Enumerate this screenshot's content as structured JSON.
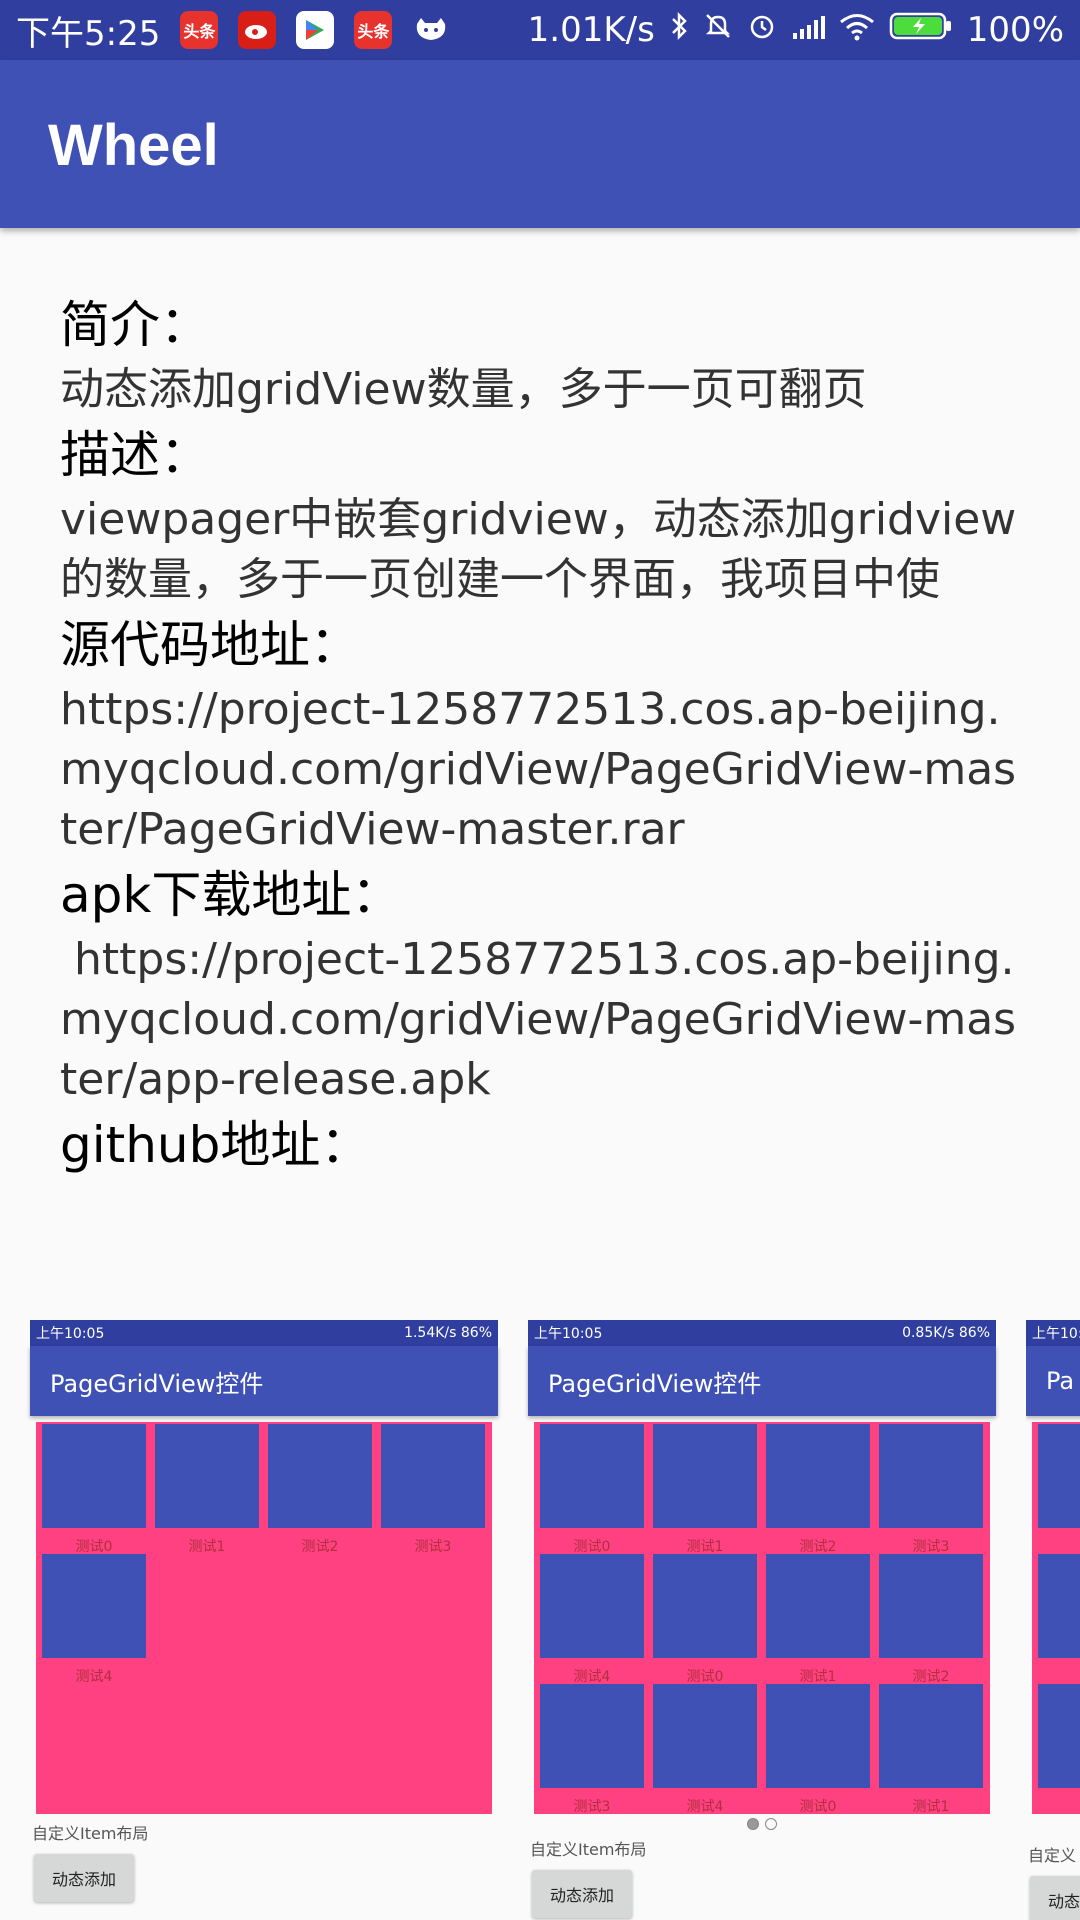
{
  "status_bar": {
    "time": "下午5:25",
    "net_speed": "1.01K/s",
    "battery": "100%",
    "app_icons": [
      "toutiao-icon",
      "weibo-icon",
      "play-store-icon",
      "toutiao-icon",
      "cat-icon"
    ]
  },
  "toolbar": {
    "title": "Wheel"
  },
  "content": {
    "intro_heading": "简介：",
    "intro_text": "动态添加gridView数量，多于一页可翻页",
    "desc_heading": "描述：",
    "desc_text": "viewpager中嵌套gridview，动态添加gridview的数量，多于一页创建一个界面，我项目中使",
    "source_heading": "源代码地址：",
    "source_url": "https://project-1258772513.cos.ap-beijing.myqcloud.com/gridView/PageGridView-master/PageGridView-master.rar",
    "apk_heading": "apk下载地址：",
    "apk_url": " https://project-1258772513.cos.ap-beijing.myqcloud.com/gridView/PageGridView-master/app-release.apk",
    "github_heading": "github地址："
  },
  "screenshots": [
    {
      "status_time": "上午10:05",
      "status_right": "1.54K/s  86%",
      "title": "PageGridView控件",
      "cells": [
        "测试0",
        "测试1",
        "测试2",
        "测试3",
        "测试4"
      ],
      "caption": "自定义Item布局",
      "button": "动态添加"
    },
    {
      "status_time": "上午10:05",
      "status_right": "0.85K/s  86%",
      "title": "PageGridView控件",
      "cells": [
        "测试0",
        "测试1",
        "测试2",
        "测试3",
        "测试4",
        "测试0",
        "测试1",
        "测试2",
        "测试3",
        "测试4",
        "测试0",
        "测试1"
      ],
      "caption": "自定义Item布局",
      "button": "动态添加"
    },
    {
      "status_time": "上午10:",
      "title": "Pa",
      "caption": "自定义",
      "button": "动态"
    }
  ]
}
